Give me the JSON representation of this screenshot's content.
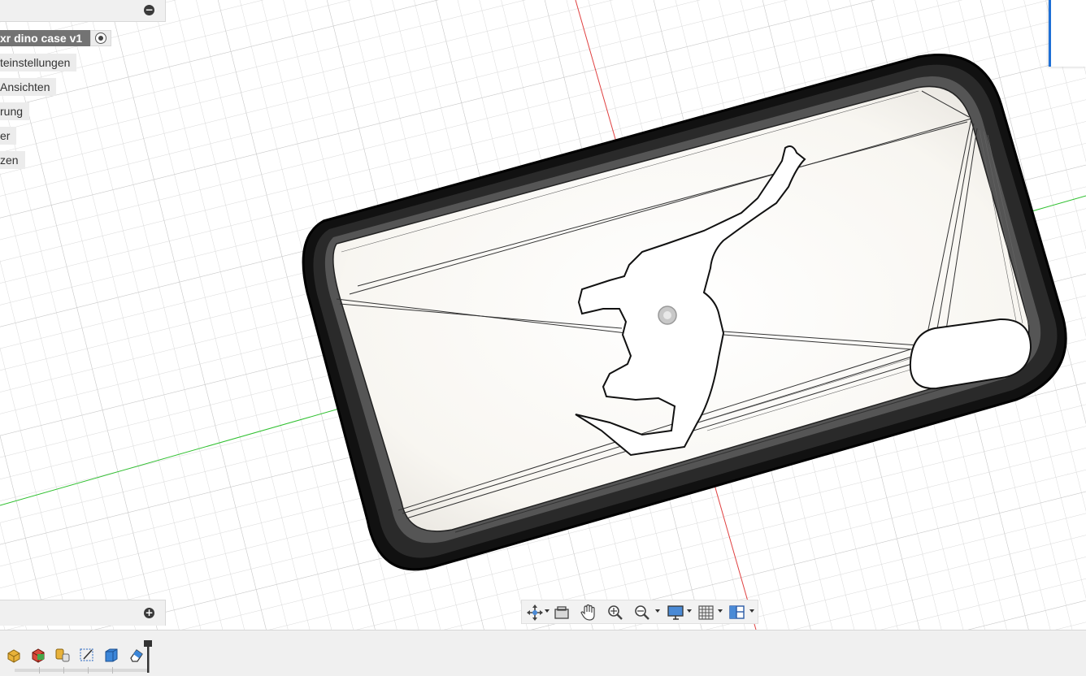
{
  "browser": {
    "root_label": "xr dino case v1",
    "items": [
      {
        "label": "teinstellungen"
      },
      {
        "label": "Ansichten"
      },
      {
        "label": "rung"
      },
      {
        "label": "er"
      },
      {
        "label": "zen"
      }
    ]
  },
  "navigation_bar": {
    "tools": [
      "orbit-icon",
      "look-at-icon",
      "pan-icon",
      "zoom-icon",
      "zoom-window-icon",
      "display-settings-icon",
      "grid-settings-icon",
      "viewports-icon"
    ]
  },
  "timeline": {
    "features": [
      "extrude-icon",
      "combine-icon",
      "split-body-icon",
      "sketch-icon",
      "body-icon",
      "eraser-icon"
    ]
  },
  "colors": {
    "x_axis": "#e04040",
    "y_axis": "#30c030",
    "accent": "#1e6fd6",
    "selected_root": "#737373"
  }
}
